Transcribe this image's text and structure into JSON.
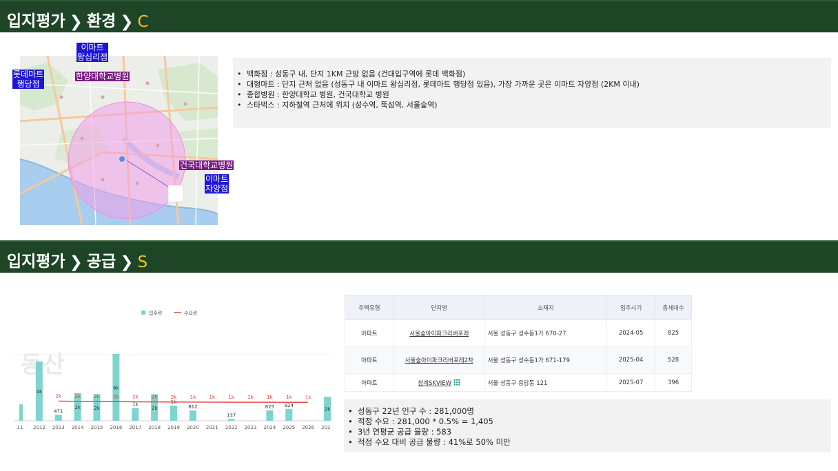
{
  "section1": {
    "title": "입지평가",
    "sub": "환경",
    "grade": "C",
    "chev": "❯",
    "map_labels": {
      "emart_wangsimni": "이마트\n왕십리점",
      "lotte_mart": "롯데마트\n행당점",
      "hanyang_hospital": "한양대학교병원",
      "konkuk_hospital": "건국대학교병원",
      "emart_jayang": "이마트\n자양점"
    },
    "bullets": [
      "백화점 : 성동구 내, 단지 1KM 근방 없음 (건대입구역에  롯데 백화점)",
      "대형마트 : 단지 근처 없음 (성동구 내  이마트 왕십리점, 롯데마트 행당점 있음), 가장 가까운 곳은 이마트 자양점 (2KM 이내)",
      "종합병원 : 한양대학교 병원, 건국대학교 병원",
      "스타벅스 : 지하철역 근처에 위치 (성수역, 뚝섬역, 서울숲역)"
    ],
    "colors": {
      "header_bg": "#1d4526",
      "grade": "#f3c32b"
    }
  },
  "section2": {
    "title": "입지평가",
    "sub": "공급",
    "grade": "S",
    "chev": "❯",
    "watermark": "동산",
    "bullets": [
      "성동구 22년 인구 수 : 281,000명",
      "적정 수요 : 281,000 * 0.5% = 1,405",
      "3년 연평균 공급 물량 : 583",
      "적정 수요 대비 공급 물량 : 41%로 50% 미만"
    ],
    "table": {
      "headers": [
        "주택유형",
        "단지명",
        "소재지",
        "입주시기",
        "총세대수"
      ],
      "rows": [
        {
          "type": "아파트",
          "name": "서울숲아이파크리버포레",
          "addr": "서울 성동구 성수동1가 670-27",
          "date": "2024-05",
          "units": "825"
        },
        {
          "type": "아파트",
          "name": "서울숲아이파크리버포레2차",
          "addr": "서울 성동구 성수동1가 671-179",
          "date": "2025-04",
          "units": "528"
        },
        {
          "type": "아파트",
          "name": "청계SKVIEW",
          "addr": "서울 성동구 용답동 121",
          "date": "2025-07",
          "units": "396"
        }
      ]
    }
  },
  "chart_data": {
    "type": "bar",
    "legend": [
      "입주량",
      "수요량"
    ],
    "legend_position": "top-center",
    "categories": [
      "2011",
      "2012",
      "2013",
      "2014",
      "2015",
      "2016",
      "2017",
      "2018",
      "2019",
      "2020",
      "2021",
      "2022",
      "2023",
      "2024",
      "2025",
      "2026",
      "2027"
    ],
    "category_labels": [
      "11",
      "2012",
      "2013",
      "2014",
      "2015",
      "2016",
      "2017",
      "2018",
      "2019",
      "2020",
      "2021",
      "2022",
      "2023",
      "2024",
      "2025",
      "2026",
      "2027"
    ],
    "series": [
      {
        "name": "입주량",
        "type": "bar",
        "color": "#7fd4cd",
        "values": [
          1300,
          4700,
          471,
          2200,
          2100,
          5300,
          1000,
          2100,
          1200,
          812,
          0,
          137,
          0,
          825,
          924,
          0,
          1900
        ],
        "labels": [
          "",
          "4k",
          "471",
          "2k",
          "2k",
          "6k",
          "1k",
          "2k",
          "1k",
          "812",
          "",
          "137",
          "",
          "825",
          "924",
          "",
          "2k"
        ]
      },
      {
        "name": "수요량",
        "type": "line",
        "color": "#e64b4b",
        "values": [
          null,
          null,
          1500,
          1480,
          1470,
          1460,
          1450,
          1440,
          1430,
          1425,
          1420,
          1415,
          1412,
          1410,
          1408,
          1405,
          null
        ],
        "labels": [
          null,
          null,
          "2k",
          "2k",
          "2k",
          "2k",
          "2k",
          "2k",
          "2k",
          "1k",
          "1k",
          "1k",
          "1k",
          "1k",
          "1k",
          "1k",
          null
        ]
      }
    ],
    "ylim": [
      0,
      6500
    ]
  }
}
